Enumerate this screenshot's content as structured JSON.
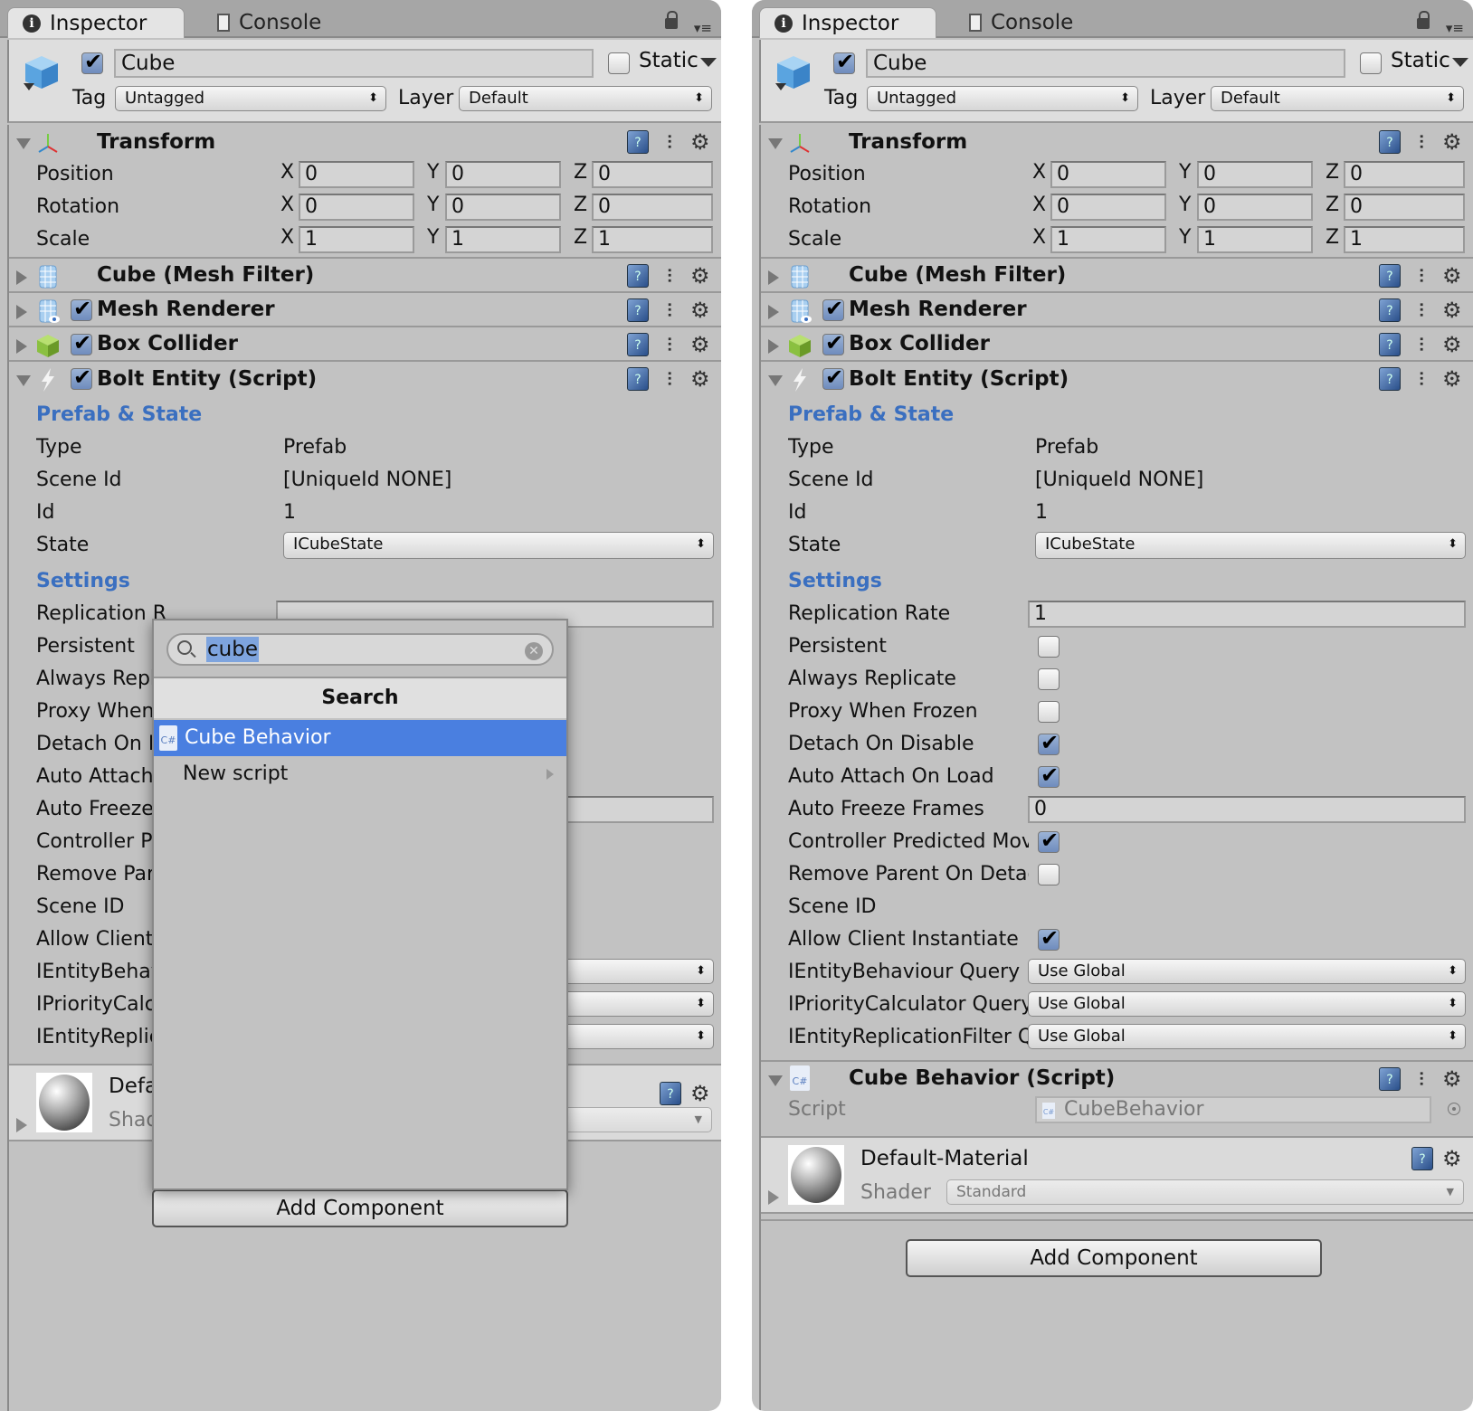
{
  "left": {
    "tabs": [
      {
        "label": "Inspector",
        "active": true
      },
      {
        "label": "Console",
        "active": false
      }
    ],
    "object": {
      "name": "Cube",
      "active": true,
      "static_label": "Static",
      "static": false,
      "tag_label": "Tag",
      "tag": "Untagged",
      "layer_label": "Layer",
      "layer": "Default"
    },
    "transform": {
      "title": "Transform",
      "rows": [
        {
          "label": "Position",
          "x": "0",
          "y": "0",
          "z": "0"
        },
        {
          "label": "Rotation",
          "x": "0",
          "y": "0",
          "z": "0"
        },
        {
          "label": "Scale",
          "x": "1",
          "y": "1",
          "z": "1"
        }
      ]
    },
    "components": [
      {
        "title": "Cube (Mesh Filter)"
      },
      {
        "title": "Mesh Renderer",
        "enabled": true
      },
      {
        "title": "Box Collider",
        "enabled": true
      },
      {
        "title": "Bolt Entity (Script)",
        "enabled": true
      }
    ],
    "bolt": {
      "prefab_section": "Prefab & State",
      "type_label": "Type",
      "type": "Prefab",
      "scene_id_label": "Scene Id",
      "scene_id": "[UniqueId NONE]",
      "id_label": "Id",
      "id": "1",
      "state_label": "State",
      "state": "ICubeState",
      "settings_section": "Settings",
      "settings_labels_truncated": [
        "Replication R",
        "Persistent",
        "Always Repli",
        "Proxy When",
        "Detach On D",
        "Auto Attach",
        "Auto Freeze",
        "Controller Pr",
        "Remove Pare",
        "Scene ID",
        "Allow Client",
        "IEntityBehav",
        "IPriorityCalcu",
        "IEntityReplic"
      ]
    },
    "material": {
      "name": "Defa",
      "shader_label": "Shad"
    },
    "dropdown": {
      "search_value": "cube",
      "header": "Search",
      "items": [
        {
          "label": "Cube Behavior",
          "selected": true,
          "icon": "C#"
        },
        {
          "label": "New script",
          "selected": false,
          "submenu": true
        }
      ]
    },
    "add_component": "Add Component"
  },
  "right": {
    "tabs": [
      {
        "label": "Inspector",
        "active": true
      },
      {
        "label": "Console",
        "active": false
      }
    ],
    "object": {
      "name": "Cube",
      "active": true,
      "static_label": "Static",
      "static": false,
      "tag_label": "Tag",
      "tag": "Untagged",
      "layer_label": "Layer",
      "layer": "Default"
    },
    "transform": {
      "title": "Transform",
      "rows": [
        {
          "label": "Position",
          "x": "0",
          "y": "0",
          "z": "0"
        },
        {
          "label": "Rotation",
          "x": "0",
          "y": "0",
          "z": "0"
        },
        {
          "label": "Scale",
          "x": "1",
          "y": "1",
          "z": "1"
        }
      ]
    },
    "components": [
      {
        "title": "Cube (Mesh Filter)"
      },
      {
        "title": "Mesh Renderer",
        "enabled": true
      },
      {
        "title": "Box Collider",
        "enabled": true
      },
      {
        "title": "Bolt Entity (Script)",
        "enabled": true
      }
    ],
    "bolt": {
      "prefab_section": "Prefab & State",
      "type_label": "Type",
      "type": "Prefab",
      "scene_id_label": "Scene Id",
      "scene_id": "[UniqueId NONE]",
      "id_label": "Id",
      "id": "1",
      "state_label": "State",
      "state": "ICubeState",
      "settings_section": "Settings",
      "settings": [
        {
          "label": "Replication Rate",
          "kind": "number",
          "value": "1"
        },
        {
          "label": "Persistent",
          "kind": "check",
          "value": false
        },
        {
          "label": "Always Replicate",
          "kind": "check",
          "value": false
        },
        {
          "label": "Proxy When Frozen",
          "kind": "check",
          "value": false
        },
        {
          "label": "Detach On Disable",
          "kind": "check",
          "value": true
        },
        {
          "label": "Auto Attach On Load",
          "kind": "check",
          "value": true
        },
        {
          "label": "Auto Freeze Frames",
          "kind": "number",
          "value": "0"
        },
        {
          "label": "Controller Predicted Move",
          "kind": "check",
          "value": true
        },
        {
          "label": "Remove Parent On Detach",
          "kind": "check",
          "value": false
        },
        {
          "label": "Scene ID",
          "kind": "none",
          "value": ""
        },
        {
          "label": "Allow Client Instantiate",
          "kind": "check",
          "value": true
        },
        {
          "label": "IEntityBehaviour Query",
          "kind": "popup",
          "value": "Use Global"
        },
        {
          "label": "IPriorityCalculator Query",
          "kind": "popup",
          "value": "Use Global"
        },
        {
          "label": "IEntityReplicationFilter Query",
          "kind": "popup",
          "value": "Use Global"
        }
      ]
    },
    "cube_behavior": {
      "title": "Cube Behavior (Script)",
      "script_label": "Script",
      "script": "CubeBehavior"
    },
    "material": {
      "name": "Default-Material",
      "shader_label": "Shader",
      "shader": "Standard"
    },
    "add_component": "Add Component"
  },
  "colors": {
    "section_blue": "#3a6fc0",
    "selection_blue": "#4a7fe0",
    "panel_bg": "#c2c2c2"
  }
}
